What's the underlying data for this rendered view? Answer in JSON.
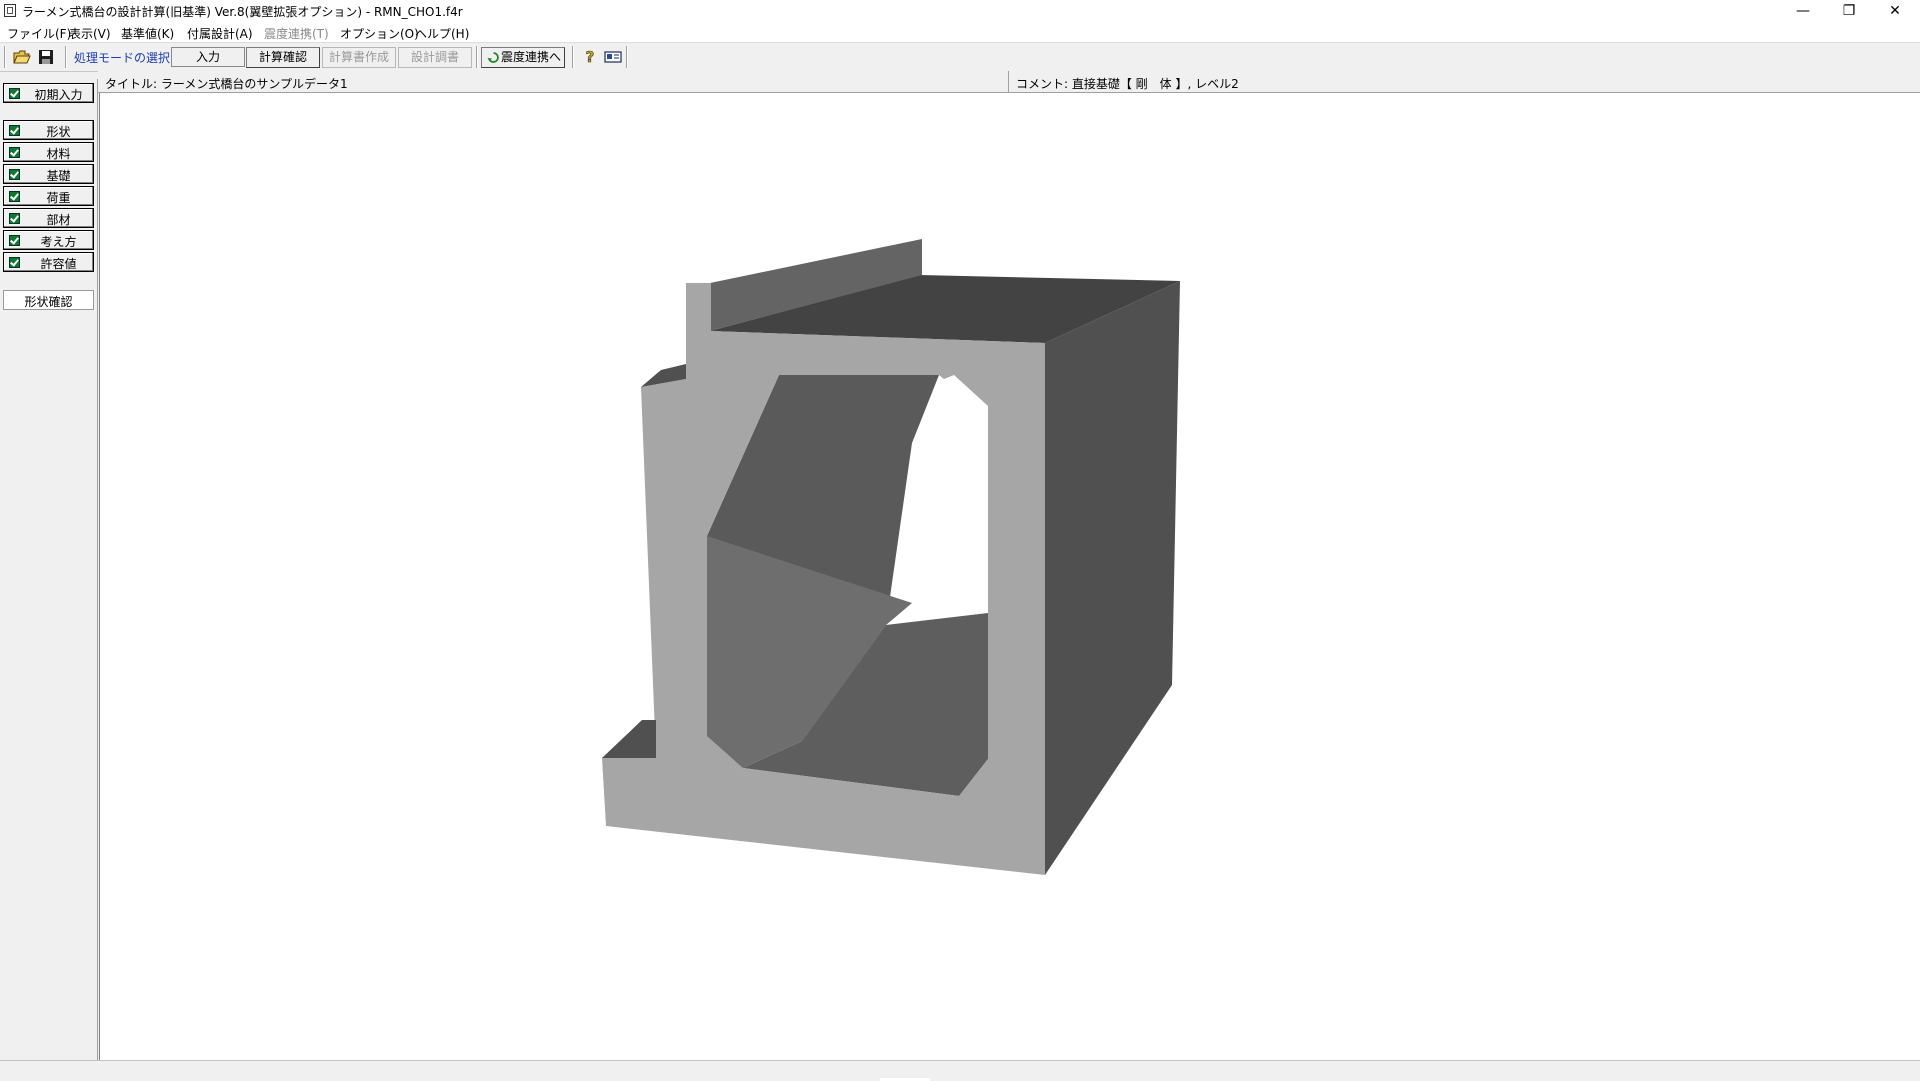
{
  "window": {
    "title": "ラーメン式橋台の設計計算(旧基準) Ver.8(翼壁拡張オプション) - RMN_CHO1.f4r",
    "minimize": "—",
    "restore": "❐",
    "close": "✕"
  },
  "menu": [
    {
      "label": "ファイル(F)",
      "enabled": true
    },
    {
      "label": "表示(V)",
      "enabled": true
    },
    {
      "label": "基準値(K)",
      "enabled": true
    },
    {
      "label": "付属設計(A)",
      "enabled": true
    },
    {
      "label": "震度連携(T)",
      "enabled": false
    },
    {
      "label": "オプション(O)",
      "enabled": true
    },
    {
      "label": "ヘルプ(H)",
      "enabled": true
    }
  ],
  "toolbar": {
    "mode_label": "処理モードの選択",
    "mode_value": "入力",
    "calc_check": "計算確認",
    "report_create": "計算書作成",
    "design_report": "設計調書",
    "seismic_link": "震度連携へ",
    "icons": [
      "open-folder-icon",
      "save-icon",
      "refresh-icon",
      "help-icon",
      "card-icon"
    ]
  },
  "sidebar": {
    "initial_input": "初期入力",
    "items": [
      "形状",
      "材料",
      "基礎",
      "荷重",
      "部材",
      "考え方",
      "許容値"
    ],
    "shape_check": "形状確認"
  },
  "info": {
    "title": "タイトル: ラーメン式橋台のサンプルデータ1",
    "comment": "コメント: 直接基礎【 剛　体 】, レベル2"
  },
  "colors": {
    "model_front": "#a6a6a6",
    "model_side": "#505050",
    "model_top": "#434343",
    "model_inner": "#5c5c5c",
    "check_green": "#0b7a2b",
    "mode_label_blue": "#1a3fb5"
  }
}
